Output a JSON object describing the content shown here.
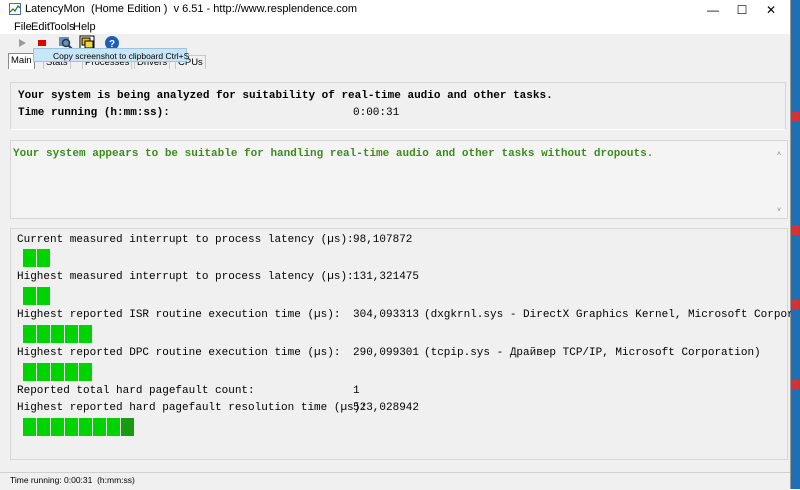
{
  "window": {
    "title": "LatencyMon  (Home Edition )  v 6.51 - http://www.resplendence.com",
    "minimize_glyph": "—",
    "maximize_glyph": "☐",
    "close_glyph": "✕"
  },
  "menu": [
    "File",
    "Edit",
    "Tools",
    "Help"
  ],
  "toolbar": {
    "play_icon": "play-icon",
    "stop_icon": "stop-icon",
    "tooltip": "Copy screenshot to clipboard Ctrl+S"
  },
  "tabs": [
    "Main",
    "Stats",
    "Processes",
    "Drivers",
    "CPUs"
  ],
  "status_panel": {
    "line1": "Your system is being analyzed for suitability of real-time audio and other tasks.",
    "time_label": "Time running (h:mm:ss):",
    "time_value": "0:00:31"
  },
  "result_panel": {
    "message": "Your system appears to be suitable for handling real-time audio and other tasks without dropouts.",
    "scroll_up": "˄",
    "scroll_down": "˅"
  },
  "metrics": [
    {
      "label": "Current measured interrupt to process latency (µs):",
      "value": "98,107872",
      "detail": "",
      "level": 2
    },
    {
      "label": "Highest measured interrupt to process latency (µs):",
      "value": "131,321475",
      "detail": "",
      "level": 2
    },
    {
      "label": "Highest reported ISR routine execution time (µs):",
      "value": "304,093313",
      "detail": "(dxgkrnl.sys - DirectX Graphics Kernel, Microsoft Corporation)",
      "level": 5
    },
    {
      "label": "Highest reported DPC routine execution time (µs):",
      "value": "290,099301",
      "detail": "(tcpip.sys - Драйвер TCP/IP, Microsoft Corporation)",
      "level": 5
    },
    {
      "label": "Reported total hard pagefault count:",
      "value": "1",
      "detail": ""
    },
    {
      "label": "Highest reported hard pagefault resolution time (µs):",
      "value": "523,028942",
      "detail": "",
      "level": 8
    }
  ],
  "status_bar": "Time running: 0:00:31  (h:mm:ss)",
  "colors": {
    "bar": "#00d400",
    "bar_peak": "#1a9a10",
    "ok_text": "#3b8d1b"
  }
}
